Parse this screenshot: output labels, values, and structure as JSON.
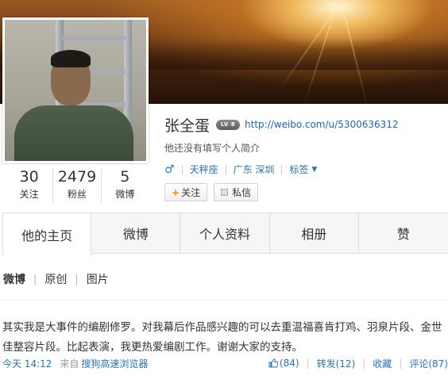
{
  "profile": {
    "name": "张全蛋",
    "level": "LV 8",
    "url": "http://weibo.com/u/5300636312",
    "bio": "他还没有填写个人简介",
    "gender_icon": "male-icon",
    "zodiac": "天秤座",
    "location": "广东 深圳",
    "tags": "标签",
    "follow_label": "关注",
    "message_label": "私信"
  },
  "stats": [
    {
      "num": "30",
      "label": "关注"
    },
    {
      "num": "2479",
      "label": "粉丝"
    },
    {
      "num": "5",
      "label": "微博"
    }
  ],
  "tabs": [
    "他的主页",
    "微博",
    "个人资料",
    "相册",
    "赞"
  ],
  "subnav": {
    "current": "微博",
    "items": [
      "原创",
      "图片"
    ]
  },
  "post": {
    "text": "其实我是大事件的编剧修罗。对我幕后作品感兴趣的可以去重温福喜肯打鸡、羽泉片段、金世佳整容片段。比起表演，我更热爱编剧工作。谢谢大家的支持。",
    "time": "今天 14:12",
    "from": "来自",
    "source": "搜狗高速浏览器",
    "likes": "(84)",
    "repost": "转发(12)",
    "favorite": "收藏",
    "comments": "评论(87)"
  },
  "colors": {
    "link": "#2a72b5",
    "accent": "#f28c00"
  }
}
